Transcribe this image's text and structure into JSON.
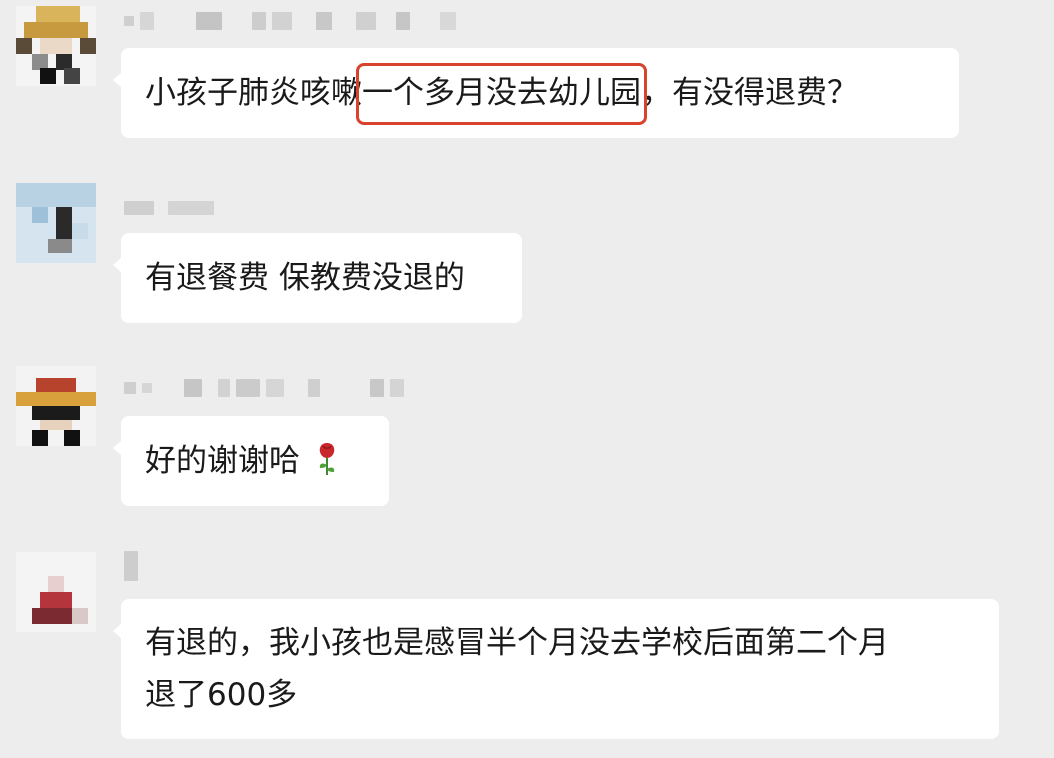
{
  "messages": [
    {
      "sender_name": "",
      "text_before": "小孩子肺炎咳嗽",
      "text_highlight": "一个多月没去幼儿园",
      "text_after": "，有没得退费？"
    },
    {
      "sender_name": "",
      "text": "有退餐费 保教费没退的"
    },
    {
      "sender_name": "",
      "text": "好的谢谢哈",
      "emoji": "rose-emoji"
    },
    {
      "sender_name": "",
      "line1": "有退的，我小孩也是感冒半个月没去学校后面第二个月",
      "line2": "退了600多"
    }
  ],
  "watermark": "",
  "colors": {
    "background": "#ededed",
    "bubble": "#ffffff",
    "highlight_border": "#d8432e",
    "text": "#1a1a1a"
  },
  "icons": [
    "avatar-image",
    "rose-emoji"
  ]
}
